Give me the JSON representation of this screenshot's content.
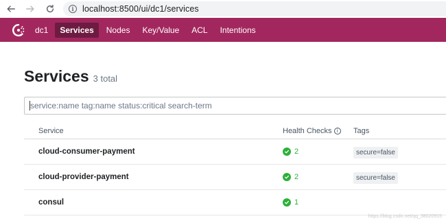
{
  "browser": {
    "url": "localhost:8500/ui/dc1/services"
  },
  "nav": {
    "datacenter": "dc1",
    "items": [
      {
        "label": "Services",
        "active": true
      },
      {
        "label": "Nodes",
        "active": false
      },
      {
        "label": "Key/Value",
        "active": false
      },
      {
        "label": "ACL",
        "active": false
      },
      {
        "label": "Intentions",
        "active": false
      }
    ],
    "brand_color": "#a2275f",
    "active_color": "#6d1b40"
  },
  "page": {
    "title": "Services",
    "count": "3 total"
  },
  "search": {
    "placeholder": "service:name tag:name status:critical search-term",
    "value": ""
  },
  "table": {
    "headers": {
      "service": "Service",
      "health": "Health Checks",
      "tags": "Tags"
    },
    "rows": [
      {
        "name": "cloud-consumer-payment",
        "checks": "2",
        "tag": "secure=false"
      },
      {
        "name": "cloud-provider-payment",
        "checks": "2",
        "tag": "secure=false"
      },
      {
        "name": "consul",
        "checks": "1",
        "tag": ""
      }
    ],
    "passing_color": "#2eb039"
  },
  "watermark": "https://blog.csdn.net/qq_38020915"
}
